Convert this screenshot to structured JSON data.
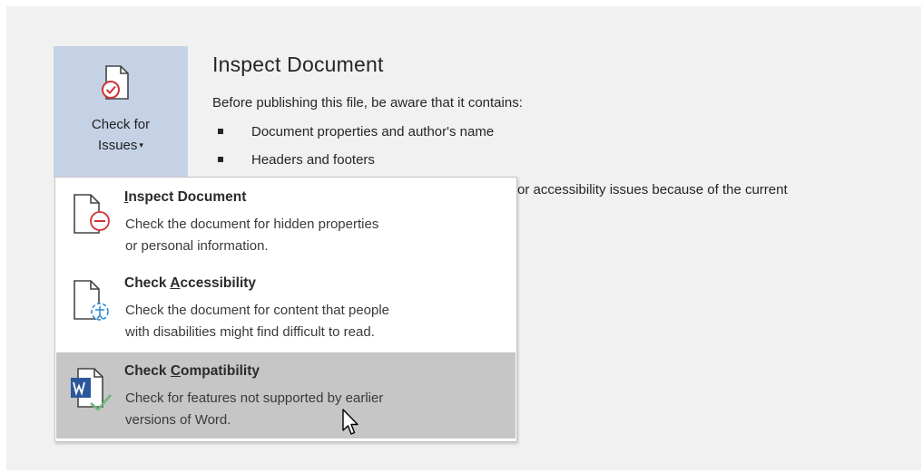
{
  "check_for_issues": {
    "line1": "Check for",
    "line2": "Issues",
    "caret": "▾",
    "icon": "document-check-icon"
  },
  "inspect_section": {
    "title": "Inspect Document",
    "description": "Before publishing this file, be aware that it contains:",
    "bullets": [
      "Document properties and author's name",
      "Headers and footers"
    ],
    "partial_text": "or accessibility issues because of the current"
  },
  "menu": {
    "items": [
      {
        "title_prefix": "",
        "title_accel": "I",
        "title_rest": "nspect Document",
        "desc_line1": "Check the document for hidden properties",
        "desc_line2": "or personal information.",
        "icon": "inspect-document-icon",
        "highlighted": false
      },
      {
        "title_prefix": "Check ",
        "title_accel": "A",
        "title_rest": "ccessibility",
        "desc_line1": "Check the document for content that people",
        "desc_line2": "with disabilities might find difficult to read.",
        "icon": "check-accessibility-icon",
        "highlighted": false
      },
      {
        "title_prefix": "Check ",
        "title_accel": "C",
        "title_rest": "ompatibility",
        "desc_line1": "Check for features not supported by earlier",
        "desc_line2": "versions of Word.",
        "icon": "check-compatibility-icon",
        "highlighted": true
      }
    ]
  },
  "colors": {
    "panel_bg": "#f1f1f1",
    "button_bg": "#c5d2e5",
    "menu_highlight": "#c6c6c6",
    "accent_red": "#d13438",
    "accent_blue": "#2b88d8",
    "word_blue": "#2b579a",
    "check_green": "#70b77e"
  }
}
